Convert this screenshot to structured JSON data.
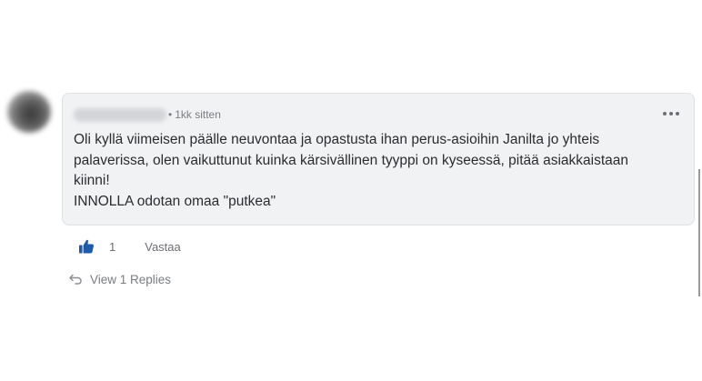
{
  "comment": {
    "timestamp": "1kk sitten",
    "meta_separator": "•",
    "text_lines": [
      "Oli kyllä viimeisen päälle neuvontaa ja opastusta ihan perus-asioihin Janilta jo yhteis",
      "palaverissa, olen vaikuttunut kuinka kärsivällinen tyyppi on kyseessä, pitää asiakkaistaan",
      "kiinni!",
      "INNOLLA odotan omaa \"putkea\""
    ]
  },
  "actions": {
    "like_count": "1",
    "reply_label": "Vastaa",
    "view_replies_label": "View 1 Replies"
  },
  "icons": {
    "like": "thumbs-up-icon",
    "more": "more-options-icon",
    "replies": "reply-arrow-icon"
  },
  "colors": {
    "bubble_background": "#f1f2f3",
    "like_icon": "#1e5aa8",
    "text": "#2a2c30",
    "muted_text": "#7a7d82"
  }
}
